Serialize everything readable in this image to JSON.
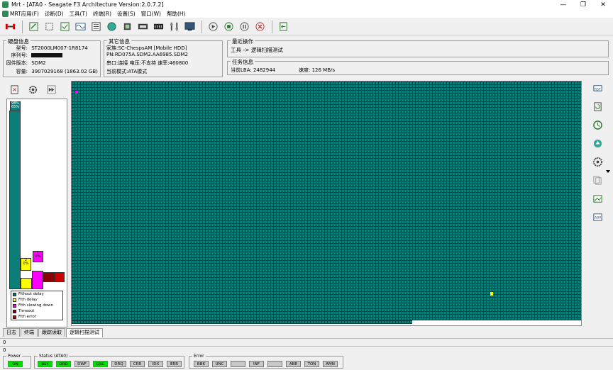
{
  "window": {
    "title": "Mrt - [ATA0 - Seagate F3 Architecture Version:2.0.7.2]",
    "minimize": "—",
    "restore": "❐",
    "close": "✕"
  },
  "menu": [
    "MRT应用(F)",
    "诊断(D)",
    "工具(T)",
    "终端(R)",
    "设置(S)",
    "窗口(W)",
    "帮助(H)"
  ],
  "disk_info": {
    "title": "硬盘信息",
    "model_label": "型号:",
    "model_value": "ST2000LM007-1R8174",
    "serial_label": "序列号:",
    "firmware_label": "固件版本:",
    "firmware_value": "SDM2",
    "capacity_label": "容量:",
    "capacity_value": "3907029168 (1863.02 GB)"
  },
  "other_info": {
    "title": "其它信息",
    "family": "家族:SC-ChespsAM [Mobile HDD]",
    "pn": "PN:RD075A.SDM2.AA6985.SDM2",
    "port": "串口:连接 电压:不支持 速率:460800",
    "mode": "当前模式:ATA模式"
  },
  "recent_op": {
    "title": "最近操作",
    "value": "工具 -> 逻辑扫描测试"
  },
  "task_info": {
    "title": "任务信息",
    "lba": "当前LBA: 2482944",
    "speed": "速度: 126 MB/s"
  },
  "histogram": {
    "bars": [
      {
        "name": "fitout",
        "label": "98%\n65%",
        "fraction": 0.98
      },
      {
        "name": "fith-delay",
        "label": "2\n0%",
        "fraction": 0.06
      },
      {
        "name": "slowing",
        "label": "1\n0%",
        "fraction": 0.09
      },
      {
        "name": "timeout",
        "label": "",
        "fraction": 0.05
      },
      {
        "name": "error",
        "label": "",
        "fraction": 0.05
      }
    ]
  },
  "legend": [
    {
      "label": "Fithout delay",
      "color": "#0b7e7a"
    },
    {
      "label": "Fith delay",
      "color": "#ffff00"
    },
    {
      "label": "Fith slowing down",
      "color": "#ff00ff"
    },
    {
      "label": "Timeout",
      "color": "#8b0000"
    },
    {
      "label": "Fith error",
      "color": "#cc0000"
    }
  ],
  "scan": {
    "progress": 0.93
  },
  "tabs": [
    "日志",
    "终端",
    "跟踪读取",
    "逻辑扫描测试"
  ],
  "log_rows": [
    "0",
    "0"
  ],
  "power": {
    "title": "Power",
    "leds": [
      "ON"
    ]
  },
  "status": {
    "title": "Status (ATA0)",
    "leds": [
      "BSY",
      "DRD",
      "DWF",
      "DSC",
      "DRQ",
      "CRR",
      "IDX",
      "ERR"
    ]
  },
  "error": {
    "title": "Error",
    "leds": [
      "BBK",
      "UNC",
      "",
      "INF",
      "",
      "ABR",
      "TON",
      "AMN"
    ]
  }
}
